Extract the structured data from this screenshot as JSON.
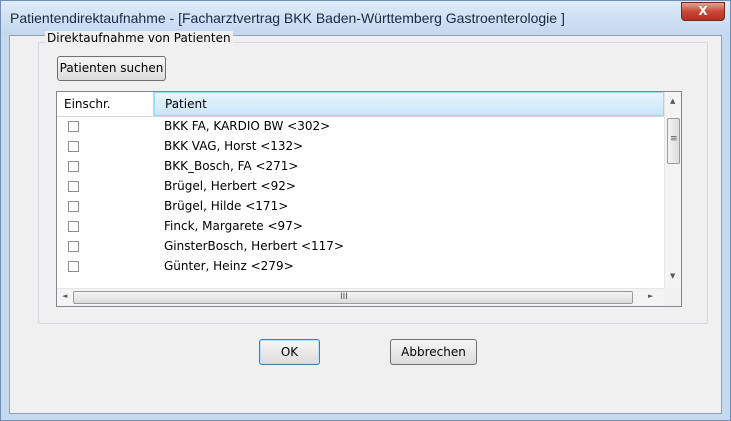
{
  "window": {
    "title": "Patientendirektaufnahme - [Facharztvertrag BKK Baden-Württemberg Gastroenterologie ]",
    "close_glyph": "X"
  },
  "group": {
    "label": "Direktaufnahme von Patienten"
  },
  "search_button": {
    "label": "Patienten suchen"
  },
  "list": {
    "columns": [
      "Einschr.",
      "Patient"
    ],
    "rows": [
      {
        "checked": false,
        "patient": "BKK FA,  KARDIO BW <302>"
      },
      {
        "checked": false,
        "patient": "BKK VAG,  Horst <132>"
      },
      {
        "checked": false,
        "patient": "BKK_Bosch,  FA <271>"
      },
      {
        "checked": false,
        "patient": "Brügel,  Herbert <92>"
      },
      {
        "checked": false,
        "patient": "Brügel,  Hilde <171>"
      },
      {
        "checked": false,
        "patient": "Finck,  Margarete <97>"
      },
      {
        "checked": false,
        "patient": "GinsterBosch,  Herbert <117>"
      },
      {
        "checked": false,
        "patient": "Günter,  Heinz <279>"
      }
    ]
  },
  "scrollbars": {
    "up": "▲",
    "down": "▼",
    "left": "◄",
    "right": "►",
    "v_grip": "≡",
    "h_grip": "III"
  },
  "buttons": {
    "ok": "OK",
    "cancel": "Abbrechen"
  },
  "colors": {
    "title_bar": "#c5d9ef",
    "close": "#c9473a",
    "header_highlight": "#c8e6f8"
  }
}
